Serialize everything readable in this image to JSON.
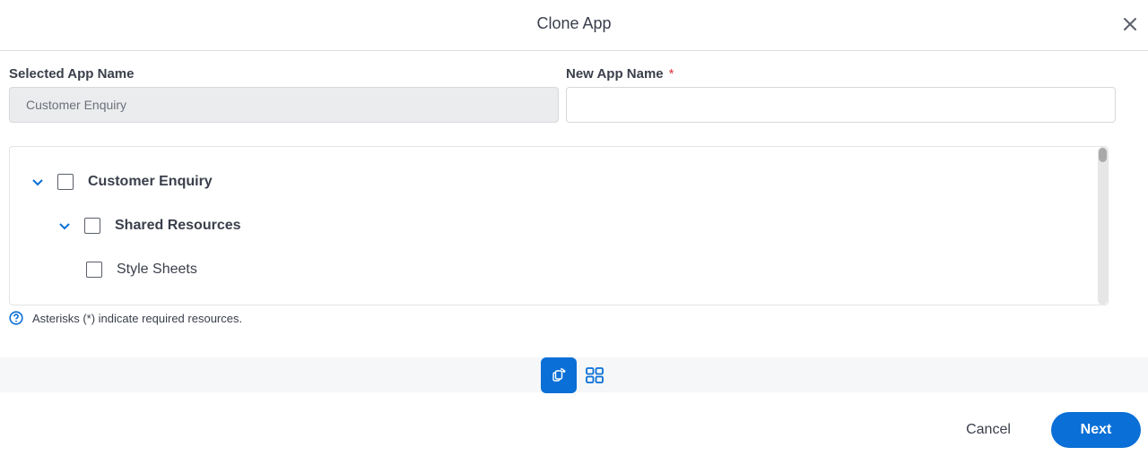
{
  "dialog": {
    "title": "Clone App",
    "close_icon": "close-icon"
  },
  "form": {
    "selected_app_label": "Selected App Name",
    "selected_app_value": "Customer Enquiry",
    "new_app_label": "New App Name",
    "new_app_required_marker": "*",
    "new_app_value": "",
    "new_app_placeholder": ""
  },
  "tree": {
    "items": [
      {
        "label": "Customer Enquiry",
        "level": 0,
        "expanded": true,
        "checked": false
      },
      {
        "label": "Shared Resources",
        "level": 1,
        "expanded": true,
        "checked": false
      },
      {
        "label": "Style Sheets",
        "level": 2,
        "expanded": null,
        "checked": false
      }
    ]
  },
  "hint": {
    "icon": "help-circle-icon",
    "text": "Asterisks (*) indicate required resources."
  },
  "toolbar": {
    "views": [
      {
        "name": "clone-view",
        "icon": "clone-icon",
        "active": true
      },
      {
        "name": "grid-view",
        "icon": "grid-icon",
        "active": false
      }
    ]
  },
  "footer": {
    "cancel_label": "Cancel",
    "next_label": "Next"
  },
  "colors": {
    "accent": "#0a6fd6",
    "required": "#d9363e",
    "disabled_field_bg": "#ebecee",
    "toolbar_bg": "#f6f7f9"
  }
}
